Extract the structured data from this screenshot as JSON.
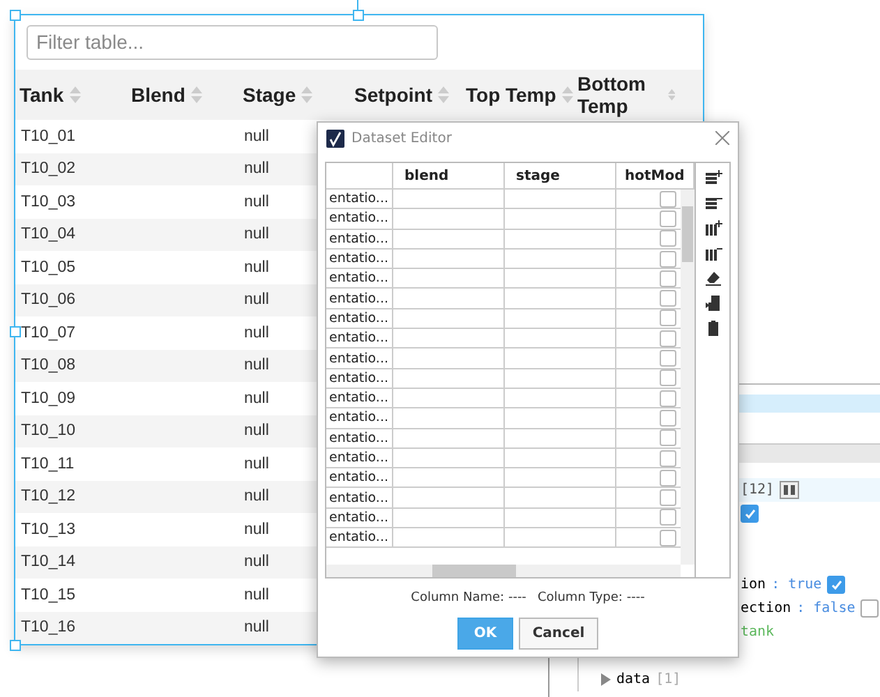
{
  "filter": {
    "placeholder": "Filter table..."
  },
  "table": {
    "columns": [
      "Tank",
      "Blend",
      "Stage",
      "Setpoint",
      "Top Temp",
      "Bottom Temp"
    ],
    "rows": [
      {
        "tank": "T10_01",
        "stage": "null"
      },
      {
        "tank": "T10_02",
        "stage": "null"
      },
      {
        "tank": "T10_03",
        "stage": "null"
      },
      {
        "tank": "T10_04",
        "stage": "null"
      },
      {
        "tank": "T10_05",
        "stage": "null"
      },
      {
        "tank": "T10_06",
        "stage": "null"
      },
      {
        "tank": "T10_07",
        "stage": "null"
      },
      {
        "tank": "T10_08",
        "stage": "null"
      },
      {
        "tank": "T10_09",
        "stage": "null"
      },
      {
        "tank": "T10_10",
        "stage": "null"
      },
      {
        "tank": "T10_11",
        "stage": "null"
      },
      {
        "tank": "T10_12",
        "stage": "null"
      },
      {
        "tank": "T10_13",
        "stage": "null"
      },
      {
        "tank": "T10_14",
        "stage": "null"
      },
      {
        "tank": "T10_15",
        "stage": "null"
      },
      {
        "tank": "T10_16",
        "stage": "null"
      }
    ]
  },
  "dialog": {
    "title": "Dataset Editor",
    "columns": [
      "blend",
      "stage",
      "hotMod"
    ],
    "rows": [
      {
        "column_1": "entatio...",
        "checked": false
      },
      {
        "column_1": "entatio...",
        "checked": false
      },
      {
        "column_1": "entatio...",
        "checked": false
      },
      {
        "column_1": "entatio...",
        "checked": false
      },
      {
        "column_1": "entatio...",
        "checked": false
      },
      {
        "column_1": "entatio...",
        "checked": false
      },
      {
        "column_1": "entatio...",
        "checked": false
      },
      {
        "column_1": "entatio...",
        "checked": false
      },
      {
        "column_1": "entatio...",
        "checked": false
      },
      {
        "column_1": "entatio...",
        "checked": false
      },
      {
        "column_1": "entatio...",
        "checked": false
      },
      {
        "column_1": "entatio...",
        "checked": false
      },
      {
        "column_1": "entatio...",
        "checked": false
      },
      {
        "column_1": "entatio...",
        "checked": false
      },
      {
        "column_1": "entatio...",
        "checked": false
      },
      {
        "column_1": "entatio...",
        "checked": false
      },
      {
        "column_1": "entatio...",
        "checked": false
      },
      {
        "column_1": "entatio...",
        "checked": false
      }
    ],
    "column_name": "Column Name: ----",
    "column_type": "Column Type: ----",
    "buttons": [
      {
        "label": "OK",
        "kind": "primary"
      },
      {
        "label": "Cancel",
        "kind": "secondary"
      }
    ]
  },
  "properties": [
    {
      "kind": "dataset",
      "value": "[12]"
    },
    {
      "kind": "check",
      "checked": true
    },
    {
      "kind": "spacer"
    },
    {
      "kind": "spacer"
    },
    {
      "kind": "boolean",
      "key": "ion",
      "value": ": true",
      "checked": true
    },
    {
      "kind": "boolean",
      "key": "ection",
      "value": ": false",
      "checked": false
    },
    {
      "kind": "string",
      "value": "tank"
    },
    {
      "kind": "spacer"
    },
    {
      "kind": "node",
      "key": "data",
      "value": "[1]",
      "expanded": false
    }
  ]
}
